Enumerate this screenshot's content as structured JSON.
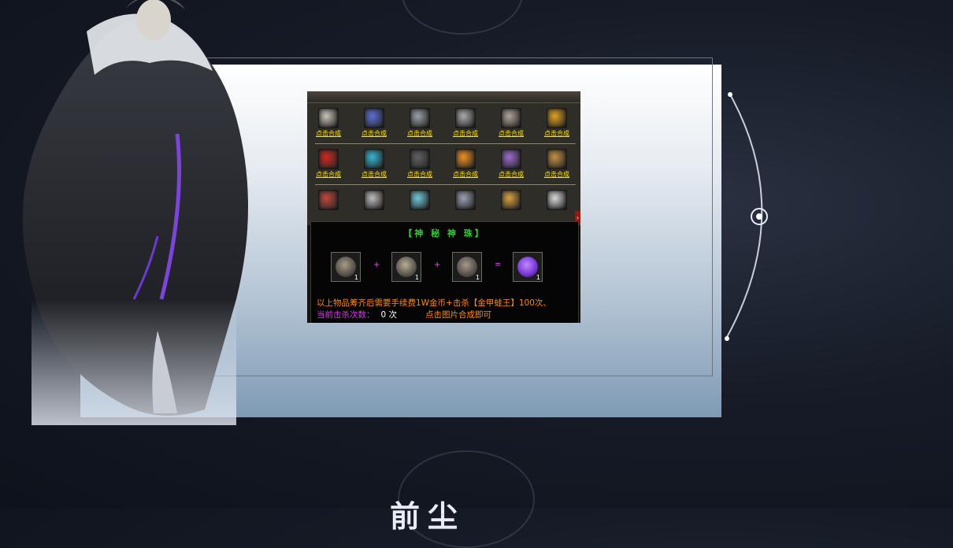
{
  "page": {
    "bottom_title": "前尘"
  },
  "game_panel": {
    "link_label": "点击合成",
    "rows": [
      {
        "items": [
          {
            "icon": "helmet-icon",
            "color": "#c9c4b8"
          },
          {
            "icon": "blue-armor-icon",
            "color": "#5b6fd6"
          },
          {
            "icon": "sword-icon",
            "color": "#9aa1a8"
          },
          {
            "icon": "axe-icon",
            "color": "#a9a9a9"
          },
          {
            "icon": "dagger-icon",
            "color": "#b0a39a"
          },
          {
            "icon": "gold-helmet-icon",
            "color": "#e0a020"
          }
        ],
        "has_links": true
      },
      {
        "items": [
          {
            "icon": "red-crystal-icon",
            "color": "#d0281e"
          },
          {
            "icon": "blue-crystal-icon",
            "color": "#35b5d0"
          },
          {
            "icon": "black-ring-icon",
            "color": "#606060"
          },
          {
            "icon": "gold-crystal-icon",
            "color": "#f09020"
          },
          {
            "icon": "purple-ring-icon",
            "color": "#9a6ad0"
          },
          {
            "icon": "amber-ring-icon",
            "color": "#c49040"
          }
        ],
        "has_links": true
      },
      {
        "items": [
          {
            "icon": "ruby-ring-icon",
            "color": "#c0463a"
          },
          {
            "icon": "silver-ring-icon",
            "color": "#bcbcbc"
          },
          {
            "icon": "aqua-ring-icon",
            "color": "#6ec7d8"
          },
          {
            "icon": "steel-ring-icon",
            "color": "#9aa0b0"
          },
          {
            "icon": "gold-bracelet-icon",
            "color": "#d8a040"
          },
          {
            "icon": "white-ring-icon",
            "color": "#d8d8d8"
          }
        ],
        "has_links": false
      }
    ],
    "recipe": {
      "title": "【神 秘 神 珠】",
      "ingredients": [
        {
          "icon": "armor-piece-icon",
          "qty": "1",
          "color": "#a89c86"
        },
        {
          "icon": "bracelet-icon",
          "qty": "1",
          "color": "#b9ad95"
        },
        {
          "icon": "gauntlet-icon",
          "qty": "1",
          "color": "#a8998a"
        }
      ],
      "plus": "+",
      "equals": "=",
      "result": {
        "icon": "mystic-orb-icon",
        "qty": "1",
        "color": "#7a3ad8"
      },
      "requirement_text": "以上物品筹齐后需要手续费1W金币+击杀【金甲蛙王】100次、",
      "kill_count_label": "当前击杀次数：",
      "kill_count_value": "0 次",
      "action_hint": "点击图片合成即可"
    }
  }
}
